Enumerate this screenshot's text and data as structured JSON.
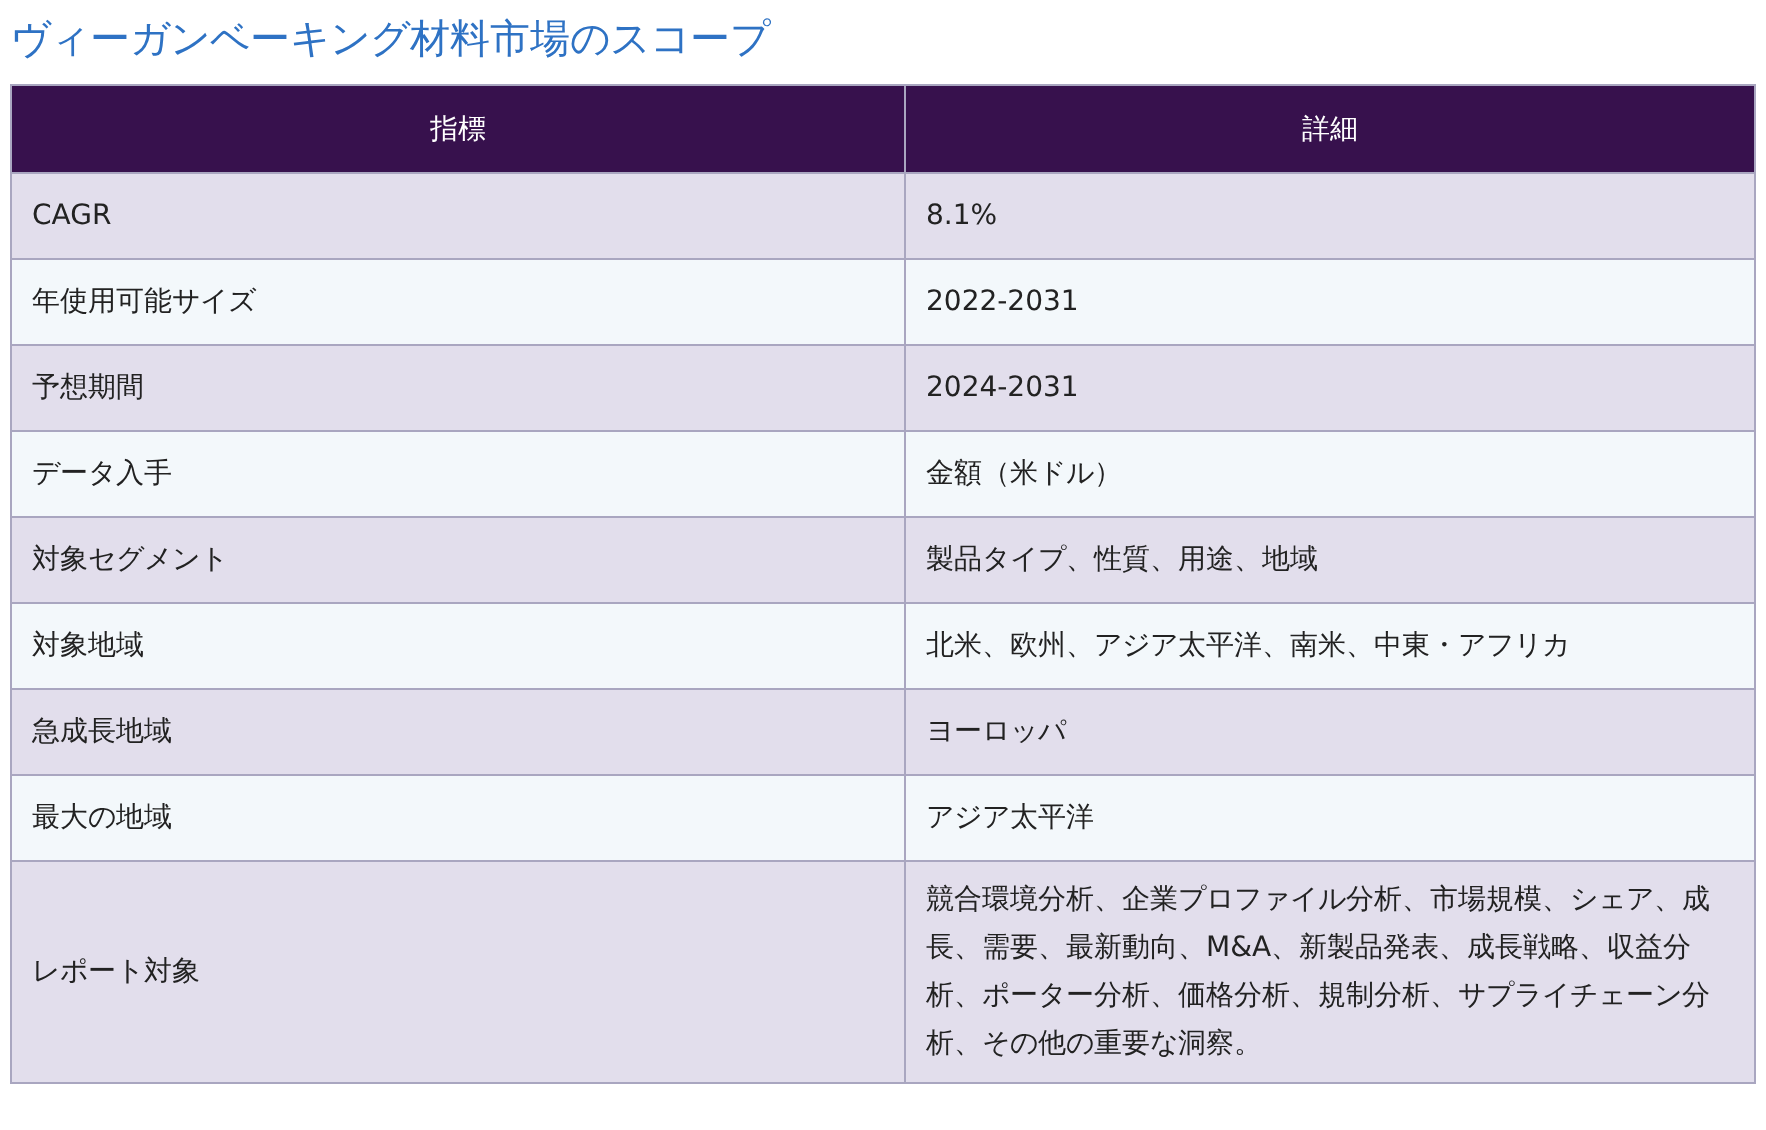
{
  "title": "ヴィーガンベーキング材料市場のスコープ",
  "table": {
    "columns": [
      "指標",
      "詳細"
    ],
    "rows": [
      {
        "label": "CAGR",
        "value": "8.1%"
      },
      {
        "label": "年使用可能サイズ",
        "value": "2022-2031"
      },
      {
        "label": "予想期間",
        "value": "2024-2031"
      },
      {
        "label": "データ入手",
        "value": "金額（米ドル）"
      },
      {
        "label": "対象セグメント",
        "value": "製品タイプ、性質、用途、地域"
      },
      {
        "label": "対象地域",
        "value": "北米、欧州、アジア太平洋、南米、中東・アフリカ"
      },
      {
        "label": "急成長地域",
        "value": "ヨーロッパ"
      },
      {
        "label": "最大の地域",
        "value": "アジア太平洋"
      },
      {
        "label": "レポート対象",
        "value": "競合環境分析、企業プロファイル分析、市場規模、シェア、成長、需要、最新動向、M&A、新製品発表、成長戦略、収益分析、ポーター分析、価格分析、規制分析、サプライチェーン分析、その他の重要な洞察。"
      }
    ]
  }
}
